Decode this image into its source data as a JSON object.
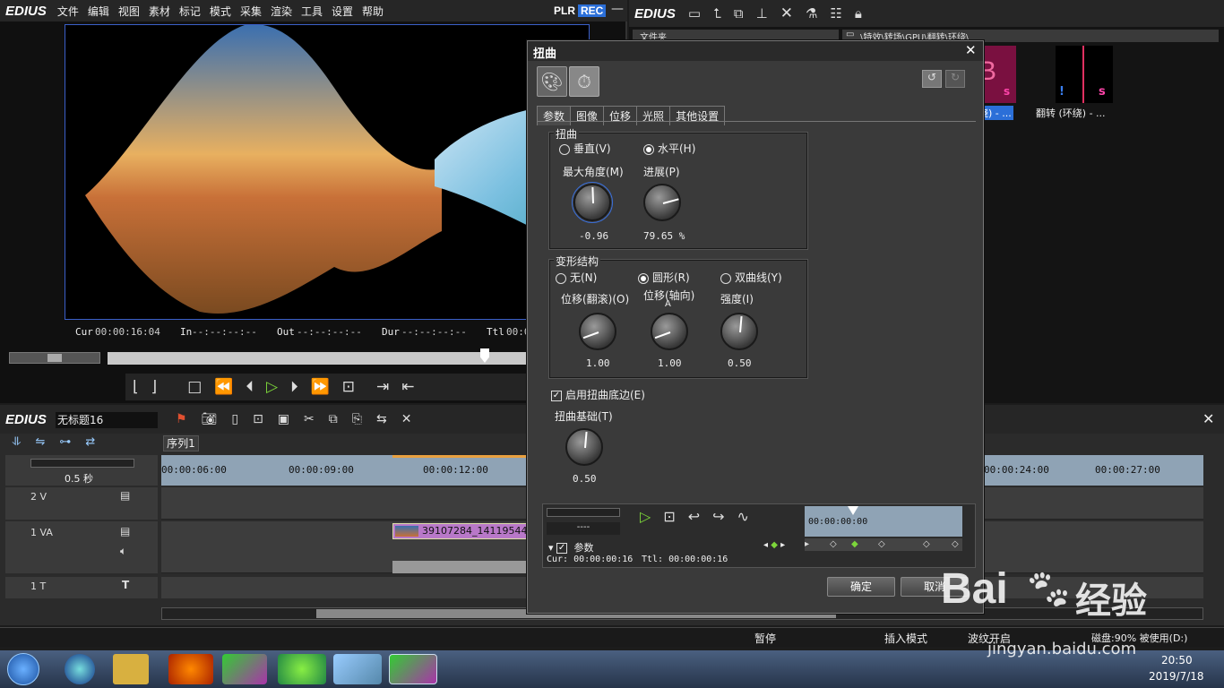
{
  "player": {
    "logo": "EDIUS",
    "menu": [
      "文件",
      "编辑",
      "视图",
      "素材",
      "标记",
      "模式",
      "采集",
      "渲染",
      "工具",
      "设置",
      "帮助"
    ],
    "mode_plr": "PLR",
    "mode_rec": "REC",
    "cur_label": "Cur",
    "cur_value": "00:00:16:04",
    "in_label": "In",
    "in_value": "--:--:--:--",
    "out_label": "Out",
    "out_value": "--:--:--:--",
    "dur_label": "Dur",
    "dur_value": "--:--:--:--",
    "ttl_label": "Ttl",
    "ttl_value": "00:0"
  },
  "bin": {
    "logo": "EDIUS",
    "folder_header": "文件夹",
    "path": "\\特效\\转场\\GPU\\翻转\\环绕\\",
    "clips": [
      {
        "label": "绕) - ..."
      },
      {
        "label": "翻转 (环绕) - ..."
      }
    ]
  },
  "timeline": {
    "logo": "EDIUS",
    "project_name": "无标题16",
    "sequence_tab": "序列1",
    "zoom_label": "0.5 秒",
    "ruler_ticks": [
      "00:00:06:00",
      "00:00:09:00",
      "00:00:12:00",
      "00:00:24:00",
      "00:00:27:00"
    ],
    "tracks": [
      {
        "name": "2 V"
      },
      {
        "name": "1 VA"
      },
      {
        "name": "1 T"
      }
    ],
    "clip_label": "39107284_14119544"
  },
  "dialog": {
    "title": "扭曲",
    "tabs": [
      "参数",
      "图像",
      "位移",
      "光照",
      "其他设置"
    ],
    "group1_title": "扭曲",
    "radio_vertical": "垂直(V)",
    "radio_horizontal": "水平(H)",
    "max_angle_label": "最大角度(M)",
    "progress_label": "进展(P)",
    "max_angle_value": "-0.96",
    "progress_value": "79.65 %",
    "group2_title": "变形结构",
    "radio_none": "无(N)",
    "radio_round": "圆形(R)",
    "radio_hyper": "双曲线(Y)",
    "offset_roll_label": "位移(翻滚)(O)",
    "offset_axis_label": "位移(轴向)",
    "offset_axis_key": "A",
    "strength_label": "强度(I)",
    "offset_roll_value": "1.00",
    "offset_axis_value": "1.00",
    "strength_value": "0.50",
    "enable_edge_label": "启用扭曲底边(E)",
    "base_label": "扭曲基础(T)",
    "base_value": "0.50",
    "kf_dash": "----",
    "kf_param_label": "参数",
    "kf_timecode": "00:00:00:00",
    "kf_cur": "Cur: 00:00:00:16",
    "kf_ttl": "Ttl: 00:00:00:16",
    "ok_label": "确定",
    "cancel_label": "取消"
  },
  "status": {
    "pause": "暂停",
    "insert_mode": "插入模式",
    "ripple": "波纹开启",
    "disk": "磁盘:90% 被使用(D:)"
  },
  "taskbar": {
    "time": "20:50",
    "date": "2019/7/18"
  },
  "watermark": {
    "brand": "Bai",
    "cn": "经验",
    "url": "jingyan.baidu.com"
  },
  "colors": {
    "accent_green": "#7cd63a",
    "rec_blue": "#2b6fd8",
    "ruler": "#8fa3b5",
    "clip_purple": "#b878c8"
  }
}
